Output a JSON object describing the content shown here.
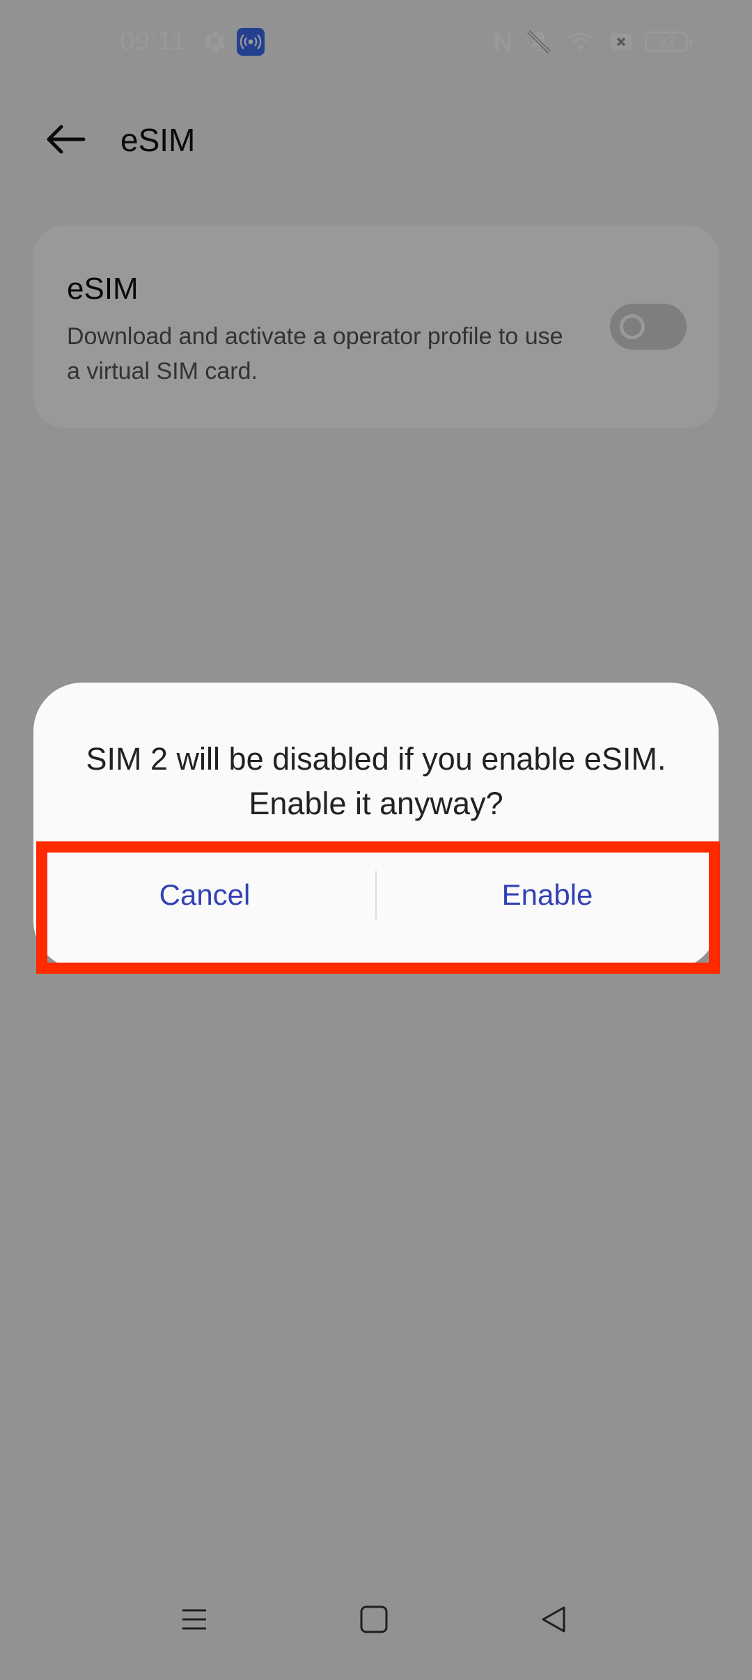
{
  "status_bar": {
    "time": "09:11",
    "battery": "93",
    "icons": [
      "settings-icon",
      "hotspot-icon",
      "nfc-icon",
      "mute-icon",
      "wifi-icon",
      "no-sim-icon"
    ]
  },
  "app_bar": {
    "title": "eSIM",
    "back_icon": "arrow-left-icon"
  },
  "esim_card": {
    "title": "eSIM",
    "description": "Download and activate a operator profile to use a virtual SIM card.",
    "toggle_on": false
  },
  "dialog": {
    "message": "SIM 2 will be disabled if you enable eSIM. Enable it anyway?",
    "cancel_label": "Cancel",
    "enable_label": "Enable"
  },
  "colors": {
    "accent": "#3341b5",
    "highlight": "#ff2a00"
  },
  "nav_bar": {
    "icons": [
      "menu-icon",
      "home-icon",
      "back-triangle-icon"
    ]
  }
}
